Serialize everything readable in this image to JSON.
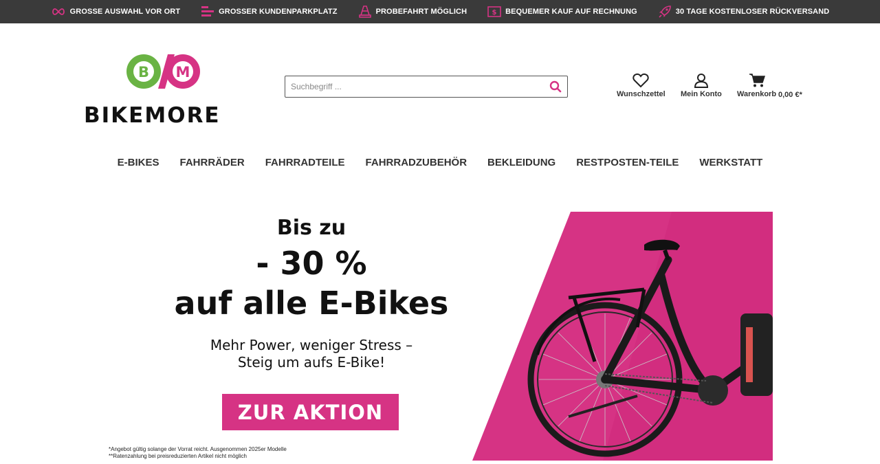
{
  "topbar": {
    "items": [
      {
        "label": "GROSSE AUSWAHL VOR ORT",
        "icon": "infinity-icon"
      },
      {
        "label": "GROSSER KUNDENPARKPLATZ",
        "icon": "parking-icon"
      },
      {
        "label": "PROBEFAHRT MÖGLICH",
        "icon": "traffic-cone-icon"
      },
      {
        "label": "BEQUEMER KAUF AUF RECHNUNG",
        "icon": "dollar-bill-icon"
      },
      {
        "label": "30 TAGE KOSTENLOSER RÜCKVERSAND",
        "icon": "rocket-icon"
      }
    ],
    "icon_color": "#d63384"
  },
  "header": {
    "logo_text": "BIKEMORE",
    "logo_letters": {
      "left": "B",
      "right": "M"
    },
    "logo_colors": {
      "green": "#6ab344",
      "magenta": "#d63384"
    },
    "search": {
      "placeholder": "Suchbegriff ...",
      "value": ""
    },
    "actions": {
      "wishlist": "Wunschzettel",
      "account": "Mein Konto",
      "cart": "Warenkorb",
      "cart_total": "0,00 €*"
    }
  },
  "nav": {
    "items": [
      "E-BIKES",
      "FAHRRÄDER",
      "FAHRRADTEILE",
      "FAHRRADZUBEHÖR",
      "BEKLEIDUNG",
      "RESTPOSTEN-TEILE",
      "WERKSTATT"
    ]
  },
  "hero": {
    "line1": "Bis zu",
    "line2": "- 30 %",
    "line3": "auf alle E-Bikes",
    "sub1": "Mehr Power, weniger Stress –",
    "sub2": "Steig um aufs E-Bike!",
    "cta": "ZUR AKTION",
    "disclaimer1": "*Angebot gültig solange der Vorrat reicht. Ausgenommen 2025er Modelle",
    "disclaimer2": "**Ratenzahlung bei preisreduzierten Artikel nicht möglich",
    "accent": "#d63384"
  }
}
